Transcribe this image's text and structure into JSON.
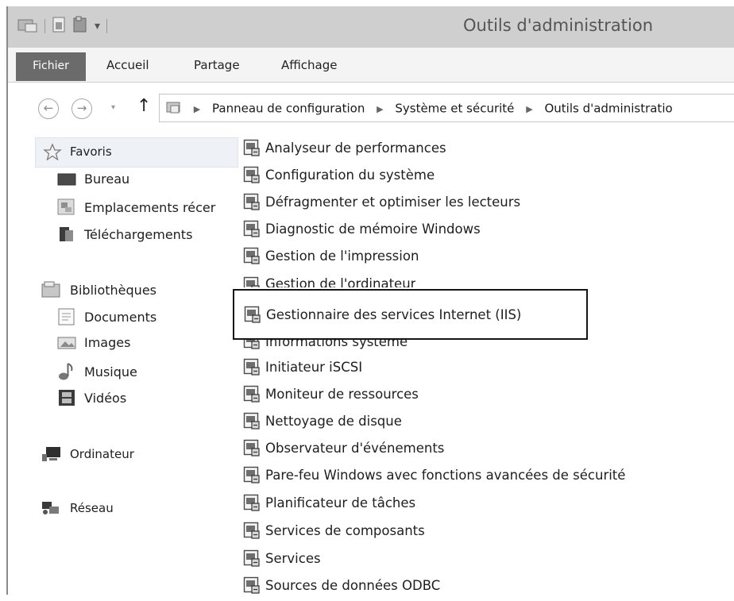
{
  "window": {
    "title": "Outils d'administration"
  },
  "ribbon": {
    "tabs": [
      "Fichier",
      "Accueil",
      "Partage",
      "Affichage"
    ]
  },
  "addressbar": {
    "breadcrumbs": [
      "Panneau de configuration",
      "Système et sécurité",
      "Outils d'administratio"
    ]
  },
  "navpane": {
    "favorites": {
      "label": "Favoris",
      "items": [
        "Bureau",
        "Emplacements récer",
        "Téléchargements"
      ]
    },
    "libraries": {
      "label": "Bibliothèques",
      "items": [
        "Documents",
        "Images",
        "Musique",
        "Vidéos"
      ]
    },
    "computer": "Ordinateur",
    "network": "Réseau"
  },
  "content": {
    "items": [
      "Analyseur de performances",
      "Configuration du système",
      "Défragmenter et optimiser les lecteurs",
      "Diagnostic de mémoire Windows",
      "Gestion de l'impression",
      "Gestion de l'ordinateur",
      "Gestionnaire des services Internet (IIS)",
      "Informations système",
      "Initiateur iSCSI",
      "Moniteur de ressources",
      "Nettoyage de disque",
      "Observateur d'événements",
      "Pare-feu Windows avec fonctions avancées de sécurité",
      "Planificateur de tâches",
      "Services de composants",
      "Services",
      "Sources de données ODBC"
    ],
    "highlighted_index": 6
  },
  "icons": {
    "admin_tool": "admin-tool-icon",
    "star": "star-icon",
    "desktop": "desktop-icon",
    "recent_places": "recent-places-icon",
    "downloads": "downloads-icon",
    "library": "library-icon",
    "documents": "documents-icon",
    "images": "images-icon",
    "music": "music-icon",
    "videos": "videos-icon",
    "computer": "computer-icon",
    "network": "network-icon"
  },
  "colors": {
    "titlebar": "#cfcfcf",
    "file_tab": "#6b6b6b",
    "highlight_border": "#151515"
  }
}
